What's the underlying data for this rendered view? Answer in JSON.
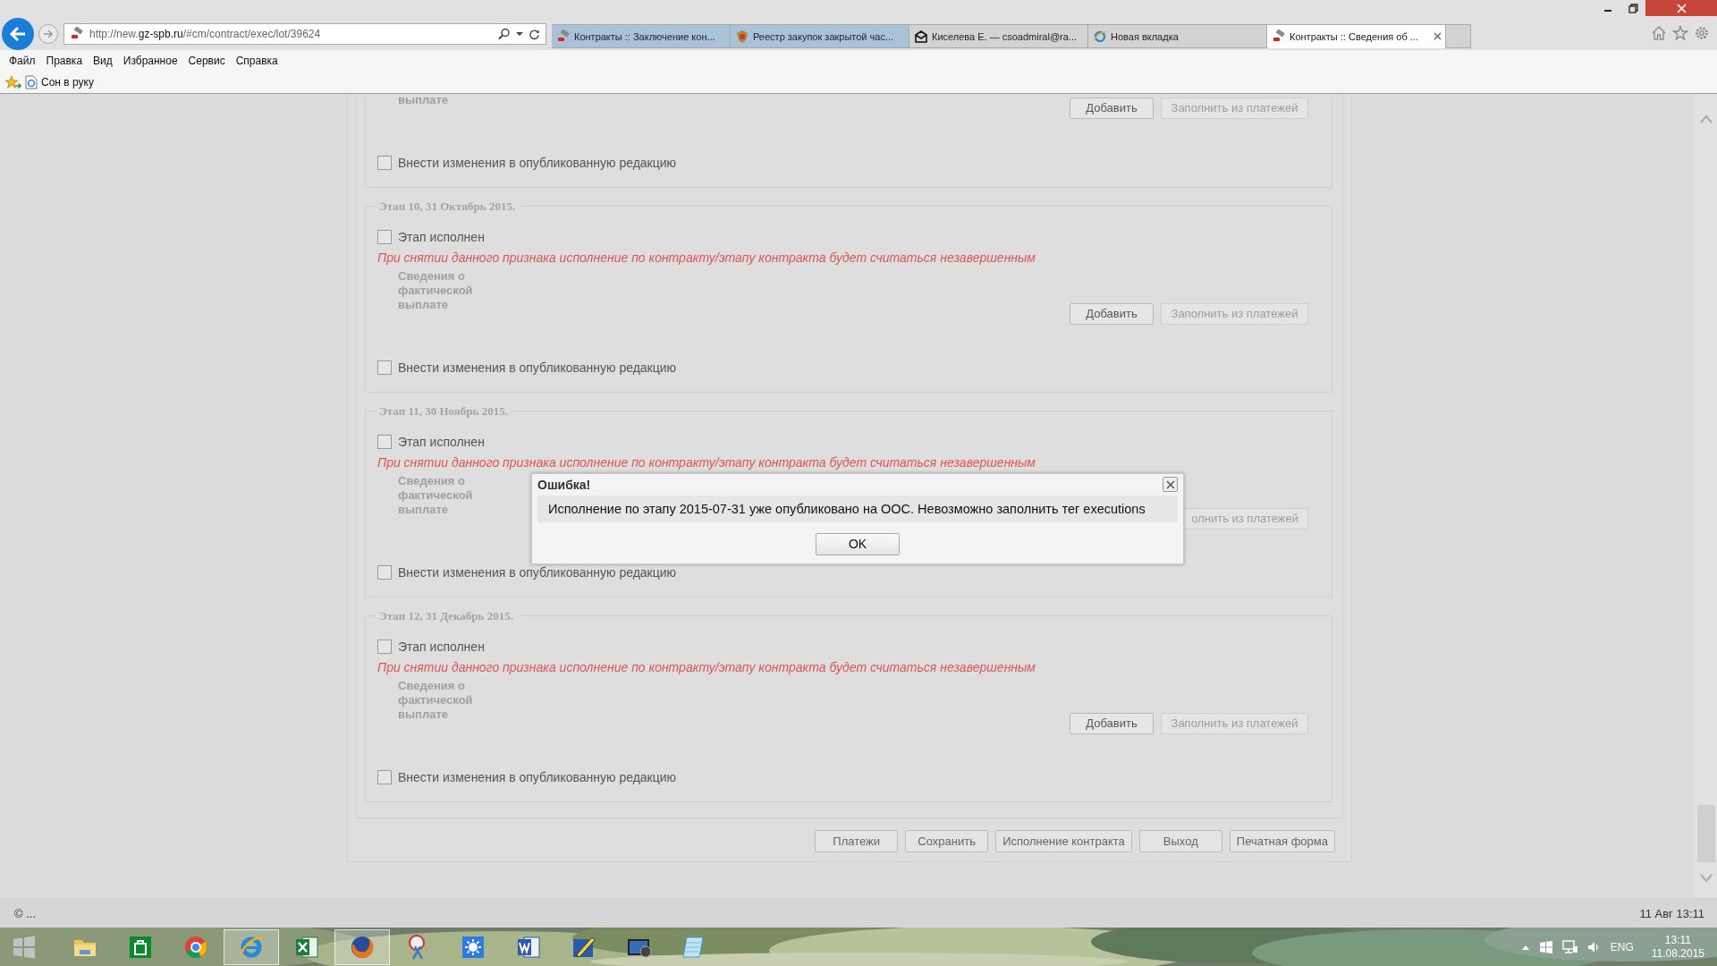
{
  "browser": {
    "address": "http://new.**gz-spb.ru**/#cm/contract/exec/lot/39624",
    "tabs": [
      {
        "title": "Контракты :: Заключение кон...",
        "selected": false,
        "color": "#a9c2da",
        "kind": "gavel"
      },
      {
        "title": "Реестр закупок закрытой час...",
        "selected": false,
        "color": "#a9c2da",
        "kind": "emblem"
      },
      {
        "title": "Киселева Е. — csoadmiral@ra...",
        "selected": false,
        "color": "#d3d3d3",
        "kind": "mail"
      },
      {
        "title": "Новая вкладка",
        "selected": false,
        "color": "#d3d3d3",
        "kind": "ie"
      },
      {
        "title": "Контракты :: Сведения об ...",
        "selected": true,
        "color": "#ffffff",
        "kind": "gavel"
      }
    ]
  },
  "menu": [
    "Файл",
    "Правка",
    "Вид",
    "Избранное",
    "Сервис",
    "Справка"
  ],
  "favorites": [
    "Сон в руку"
  ],
  "partial_stage": {
    "info_label": "выплате",
    "buttons": [
      {
        "label": "Добавить",
        "disabled": false,
        "kind": "add"
      },
      {
        "label": "Заполнить из платежей",
        "disabled": true,
        "kind": "fill"
      }
    ],
    "publish": {
      "label": "Внести изменения в опубликованную редакцию",
      "checked": false
    }
  },
  "stages": [
    {
      "title": "Этап 10, 31 Октябрь 2015.",
      "done": {
        "label": "Этап исполнен",
        "checked": false
      },
      "warning": "При снятии данного признака исполнение по контракту/этапу контракта будет считаться незавершенным",
      "info_label": "Сведения о фактической выплате",
      "buttons": [
        {
          "label": "Добавить",
          "disabled": false,
          "kind": "add"
        },
        {
          "label": "Заполнить из платежей",
          "disabled": true,
          "kind": "fill"
        }
      ],
      "publish": {
        "label": "Внести изменения в опубликованную редакцию",
        "checked": false
      }
    },
    {
      "title": "Этап 11, 30 Ноябрь 2015.",
      "done": {
        "label": "Этап исполнен",
        "checked": false
      },
      "warning": "При снятии данного признака исполнение по контракту/этапу контракта будет считаться незавершенным",
      "info_label": "Сведения о фактической выплате",
      "buttons": [
        {
          "label": "олнить из платежей",
          "disabled": true,
          "kind": "fill",
          "cut": true
        }
      ],
      "publish": {
        "label": "Внести изменения в опубликованную редакцию",
        "checked": false
      }
    },
    {
      "title": "Этап 12, 31 Декабрь 2015.",
      "done": {
        "label": "Этап исполнен",
        "checked": false
      },
      "warning": "При снятии данного признака исполнение по контракту/этапу контракта будет считаться незавершенным",
      "info_label": "Сведения о фактической выплате",
      "buttons": [
        {
          "label": "Добавить",
          "disabled": false,
          "kind": "add"
        },
        {
          "label": "Заполнить из платежей",
          "disabled": true,
          "kind": "fill"
        }
      ],
      "publish": {
        "label": "Внести изменения в опубликованную редакцию",
        "checked": false
      }
    }
  ],
  "actions": [
    "Платежи",
    "Сохранить",
    "Исполнение контракта",
    "Выход",
    "Печатная форма"
  ],
  "dialog": {
    "title": "Ошибка!",
    "message": "Исполнение по этапу 2015-07-31 уже опубликовано на ООС. Невозможно заполнить тег executions",
    "button": "OK"
  },
  "status_bar": {
    "left": "© ...",
    "right": "11 Авг 13:11"
  },
  "taskbar": {
    "apps": [
      {
        "kind": "folder",
        "active": false
      },
      {
        "kind": "store",
        "active": false
      },
      {
        "kind": "chrome",
        "active": false
      },
      {
        "kind": "ie",
        "active": true
      },
      {
        "kind": "excel",
        "active": false
      },
      {
        "kind": "firefox",
        "active": true
      },
      {
        "kind": "scissors",
        "active": false
      },
      {
        "kind": "sun",
        "active": false
      },
      {
        "kind": "word",
        "active": false
      },
      {
        "kind": "pen",
        "active": false
      },
      {
        "kind": "video",
        "active": false
      },
      {
        "kind": "notepad",
        "active": false
      }
    ],
    "language": "ENG",
    "time": "13:11",
    "date": "11.08.2015"
  }
}
